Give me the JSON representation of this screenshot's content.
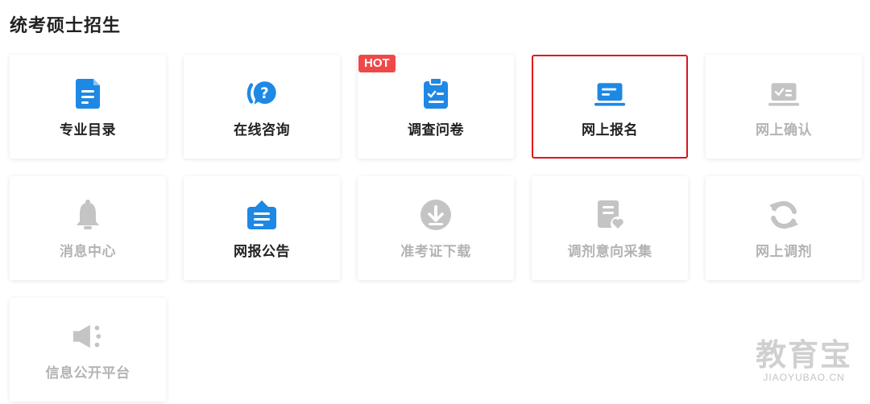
{
  "section": {
    "title": "统考硕士招生"
  },
  "colors": {
    "accent": "#1e88e5",
    "disabled": "#c4c4c4",
    "badge": "#f04848",
    "selected_border": "#e0141e"
  },
  "cards": [
    {
      "label": "专业目录",
      "icon": "document-list-icon",
      "enabled": true
    },
    {
      "label": "在线咨询",
      "icon": "chat-question-icon",
      "enabled": true
    },
    {
      "label": "调查问卷",
      "icon": "clipboard-check-icon",
      "enabled": true,
      "badge": "HOT"
    },
    {
      "label": "网上报名",
      "icon": "laptop-form-icon",
      "enabled": true,
      "selected": true
    },
    {
      "label": "网上确认",
      "icon": "laptop-check-icon",
      "enabled": false
    },
    {
      "label": "消息中心",
      "icon": "bell-icon",
      "enabled": false
    },
    {
      "label": "网报公告",
      "icon": "notice-bag-icon",
      "enabled": true
    },
    {
      "label": "准考证下载",
      "icon": "download-circle-icon",
      "enabled": false
    },
    {
      "label": "调剂意向采集",
      "icon": "doc-heart-icon",
      "enabled": false
    },
    {
      "label": "网上调剂",
      "icon": "refresh-icon",
      "enabled": false
    },
    {
      "label": "信息公开平台",
      "icon": "speaker-icon",
      "enabled": false
    }
  ],
  "watermark": {
    "cn": "教育宝",
    "en": "JIAOYUBAO.CN"
  }
}
